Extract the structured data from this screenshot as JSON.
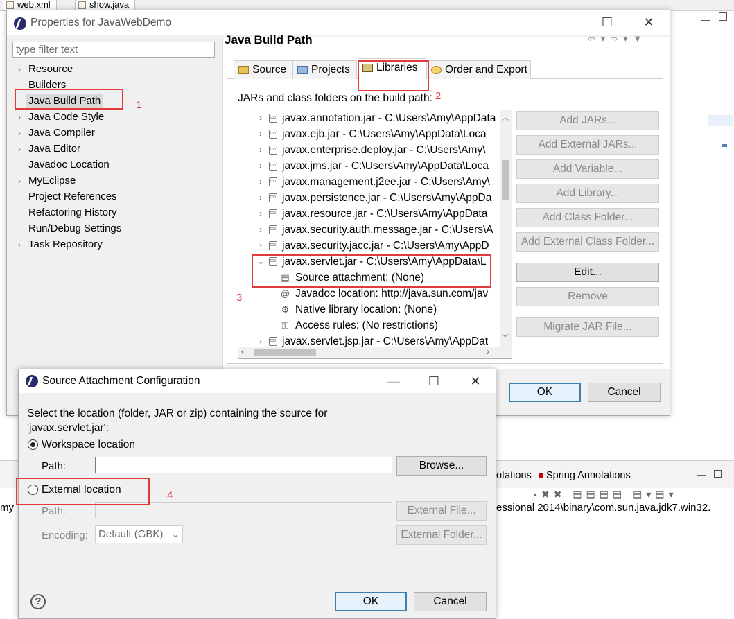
{
  "ide": {
    "tabs": [
      "web.xml",
      "show.java"
    ],
    "console_fragment": "my",
    "console_path": "essional 2014\\binary\\com.sun.java.jdk7.win32.",
    "bottom_tabs": [
      "otations",
      "Spring Annotations"
    ]
  },
  "properties": {
    "title": "Properties for JavaWebDemo",
    "filter_placeholder": "type filter text",
    "nav_items": [
      {
        "label": "Resource",
        "expandable": true
      },
      {
        "label": "Builders",
        "expandable": false
      },
      {
        "label": "Java Build Path",
        "expandable": false,
        "selected": true
      },
      {
        "label": "Java Code Style",
        "expandable": true
      },
      {
        "label": "Java Compiler",
        "expandable": true
      },
      {
        "label": "Java Editor",
        "expandable": true
      },
      {
        "label": "Javadoc Location",
        "expandable": false
      },
      {
        "label": "MyEclipse",
        "expandable": true
      },
      {
        "label": "Project References",
        "expandable": false
      },
      {
        "label": "Refactoring History",
        "expandable": false
      },
      {
        "label": "Run/Debug Settings",
        "expandable": false
      },
      {
        "label": "Task Repository",
        "expandable": true
      }
    ],
    "page_title": "Java Build Path",
    "tabs": [
      "Source",
      "Projects",
      "Libraries",
      "Order and Export"
    ],
    "active_tab": "Libraries",
    "libraries_caption": "JARs and class folders on the build path:",
    "libraries": [
      "javax.annotation.jar - C:\\Users\\Amy\\AppData",
      "javax.ejb.jar - C:\\Users\\Amy\\AppData\\Loca",
      "javax.enterprise.deploy.jar - C:\\Users\\Amy\\",
      "javax.jms.jar - C:\\Users\\Amy\\AppData\\Loca",
      "javax.management.j2ee.jar - C:\\Users\\Amy\\",
      "javax.persistence.jar - C:\\Users\\Amy\\AppDa",
      "javax.resource.jar - C:\\Users\\Amy\\AppData",
      "javax.security.auth.message.jar - C:\\Users\\A",
      "javax.security.jacc.jar - C:\\Users\\Amy\\AppD",
      "javax.servlet.jar - C:\\Users\\Amy\\AppData\\L",
      "javax.servlet.jsp.jar - C:\\Users\\Amy\\AppDat"
    ],
    "expanded_children": [
      "Source attachment: (None)",
      "Javadoc location: http://java.sun.com/jav",
      "Native library location: (None)",
      "Access rules: (No restrictions)"
    ],
    "side_buttons": [
      {
        "label": "Add JARs...",
        "enabled": false
      },
      {
        "label": "Add External JARs...",
        "enabled": false
      },
      {
        "label": "Add Variable...",
        "enabled": false
      },
      {
        "label": "Add Library...",
        "enabled": false
      },
      {
        "label": "Add Class Folder...",
        "enabled": false
      },
      {
        "label": "Add External Class Folder...",
        "enabled": false
      },
      {
        "label": "Edit...",
        "enabled": true
      },
      {
        "label": "Remove",
        "enabled": false
      },
      {
        "label": "Migrate JAR File...",
        "enabled": false
      }
    ],
    "ok_label": "OK",
    "cancel_label": "Cancel"
  },
  "source_attachment": {
    "title": "Source Attachment Configuration",
    "instruction_line1": "Select the location (folder, JAR or zip) containing the source for",
    "instruction_line2": "'javax.servlet.jar':",
    "workspace_label": "Workspace location",
    "workspace_selected": true,
    "path_label": "Path:",
    "workspace_path_value": "",
    "browse_label": "Browse...",
    "external_label": "External location",
    "external_path_label": "Path:",
    "external_path_value": "",
    "external_file_label": "External File...",
    "encoding_label": "Encoding:",
    "encoding_value": "Default (GBK)",
    "external_folder_label": "External Folder...",
    "ok_label": "OK",
    "cancel_label": "Cancel",
    "help_symbol": "?"
  },
  "annotations": [
    "1",
    "2",
    "3",
    "4"
  ],
  "colors": {
    "annotation": "#e23a3a",
    "default_button_border": "#3c7fb1"
  }
}
